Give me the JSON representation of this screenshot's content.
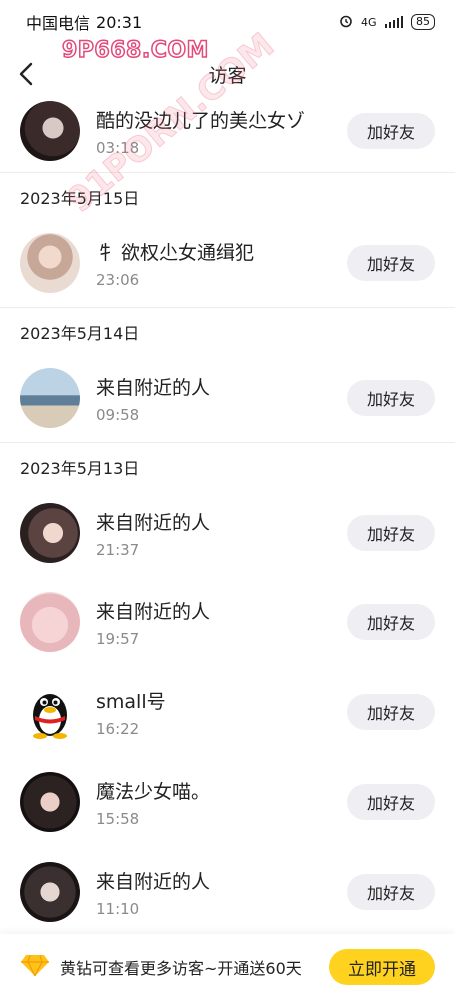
{
  "status_bar": {
    "carrier": "中国电信",
    "time": "20:31",
    "network": "4G",
    "battery": "85"
  },
  "nav": {
    "title": "访客"
  },
  "watermark": {
    "top": "9P668.COM",
    "diagonal": "91PORN.COM"
  },
  "colors": {
    "accent": "#ffd21f",
    "button_bg": "#efeff3",
    "watermark": "#e24a7a"
  },
  "visitors": {
    "row0": {
      "name": "酷的没边儿了的美尐女ゾ",
      "time": "03:18",
      "button": "加好友"
    },
    "date1": "2023年5月15日",
    "row1": {
      "name": "牜 欲权尐女通缉犯",
      "time": "23:06",
      "button": "加好友"
    },
    "date2": "2023年5月14日",
    "row2": {
      "name": "来自附近的人",
      "time": "09:58",
      "button": "加好友"
    },
    "date3": "2023年5月13日",
    "row3": {
      "name": "来自附近的人",
      "time": "21:37",
      "button": "加好友"
    },
    "row4": {
      "name": "来自附近的人",
      "time": "19:57",
      "button": "加好友"
    },
    "row5": {
      "name": "small号",
      "time": "16:22",
      "button": "加好友"
    },
    "row6": {
      "name": "魔法少女喵。",
      "time": "15:58",
      "button": "加好友"
    },
    "row7": {
      "name": "来自附近的人",
      "time": "11:10",
      "button": "加好友"
    }
  },
  "footer": {
    "text": "黄钻可查看更多访客~开通送60天",
    "button": "立即开通",
    "icon": "diamond-icon"
  }
}
